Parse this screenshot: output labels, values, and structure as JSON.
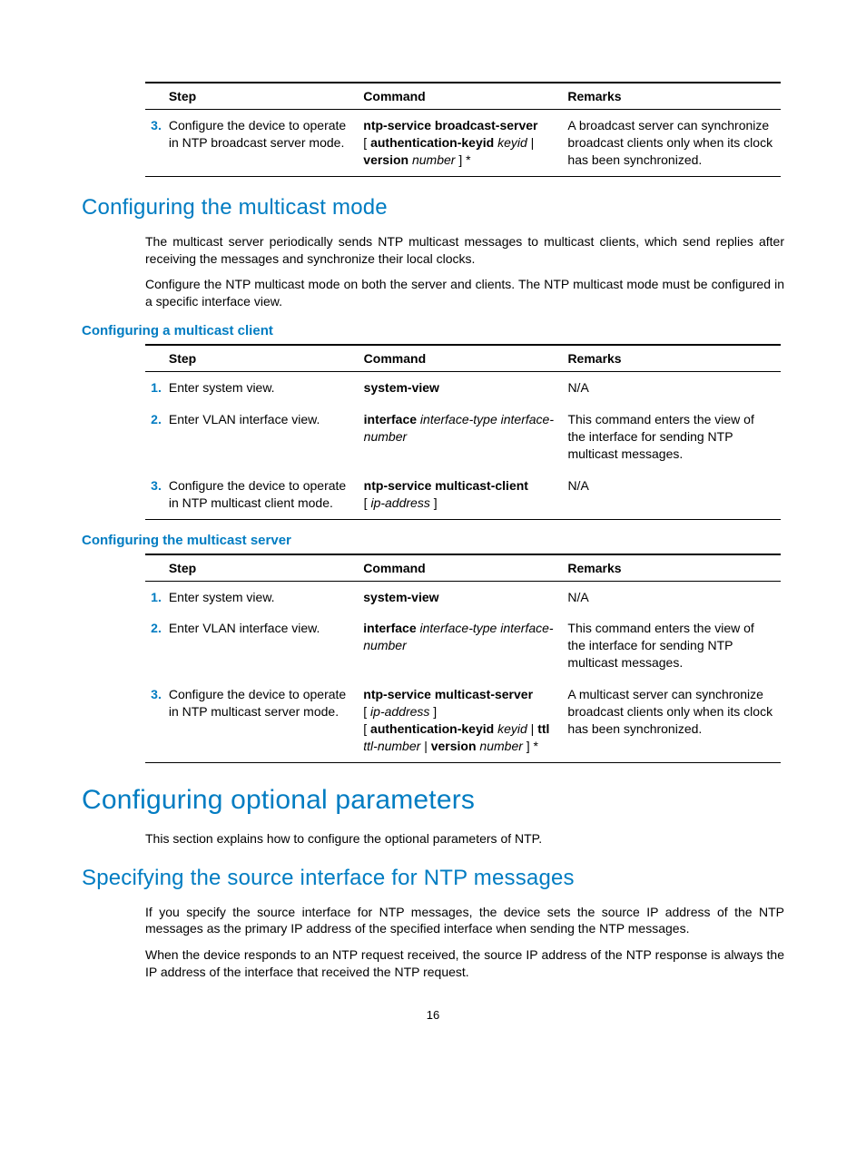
{
  "headers": {
    "step": "Step",
    "command": "Command",
    "remarks": "Remarks"
  },
  "table1": {
    "rows": [
      {
        "num": "3.",
        "step": "Configure the device to operate in NTP broadcast server mode.",
        "cmd_b1": "ntp-service broadcast-server",
        "cmd_open": "[ ",
        "cmd_b2": "authentication-keyid",
        "cmd_i1": " keyid ",
        "cmd_pipe": "| ",
        "cmd_b3": "version",
        "cmd_i2": " number",
        "cmd_close": " ] *",
        "remarks": "A broadcast server can synchronize broadcast clients only when its clock has been synchronized."
      }
    ]
  },
  "h2_multicast": "Configuring the multicast mode",
  "p_multicast_1": "The multicast server periodically sends NTP multicast messages to multicast clients, which send replies after receiving the messages and synchronize their local clocks.",
  "p_multicast_2": "Configure the NTP multicast mode on both the server and clients. The NTP multicast mode must be configured in a specific interface view.",
  "h3_mc_client": "Configuring a multicast client",
  "table2": {
    "rows": [
      {
        "num": "1.",
        "step": "Enter system view.",
        "cmd_b1": "system-view",
        "remarks": "N/A"
      },
      {
        "num": "2.",
        "step": "Enter VLAN interface view.",
        "cmd_b1": "interface",
        "cmd_i1": " interface-type interface-number",
        "remarks": "This command enters the view of the interface for sending NTP multicast messages."
      },
      {
        "num": "3.",
        "step": "Configure the device to operate in NTP multicast client mode.",
        "cmd_b1": "ntp-service multicast-client",
        "cmd_open": " [ ",
        "cmd_i1": "ip-address",
        "cmd_close": " ]",
        "remarks": "N/A"
      }
    ]
  },
  "h3_mc_server": "Configuring the multicast server",
  "table3": {
    "rows": [
      {
        "num": "1.",
        "step": "Enter system view.",
        "cmd_b1": "system-view",
        "remarks": "N/A"
      },
      {
        "num": "2.",
        "step": "Enter VLAN interface view.",
        "cmd_b1": "interface",
        "cmd_i1": " interface-type interface-number",
        "remarks": "This command enters the view of the interface for sending NTP multicast messages."
      },
      {
        "num": "3.",
        "step": "Configure the device to operate in NTP multicast server mode.",
        "cmd_b1": "ntp-service multicast-server",
        "cmd_open": " [ ",
        "cmd_i1": "ip-address",
        "cmd_close": " ] ",
        "cmd_open2": "[ ",
        "cmd_b2": "authentication-keyid",
        "cmd_i2": " keyid ",
        "cmd_pipe": "| ",
        "cmd_b3": "ttl",
        "cmd_i3": " ttl-number ",
        "cmd_pipe2": "| ",
        "cmd_b4": "version",
        "cmd_i4": " number",
        "cmd_close2": " ] *",
        "remarks": "A multicast server can synchronize broadcast clients only when its clock has been synchronized."
      }
    ]
  },
  "h1_opt": "Configuring optional parameters",
  "p_opt_1": "This section explains how to configure the optional parameters of NTP.",
  "h2_src": "Specifying the source interface for NTP messages",
  "p_src_1": "If you specify the source interface for NTP messages, the device sets the source IP address of the NTP messages as the primary IP address of the specified interface when sending the NTP messages.",
  "p_src_2": "When the device responds to an NTP request received, the source IP address of the NTP response is always the IP address of the interface that received the NTP request.",
  "page_num": "16"
}
